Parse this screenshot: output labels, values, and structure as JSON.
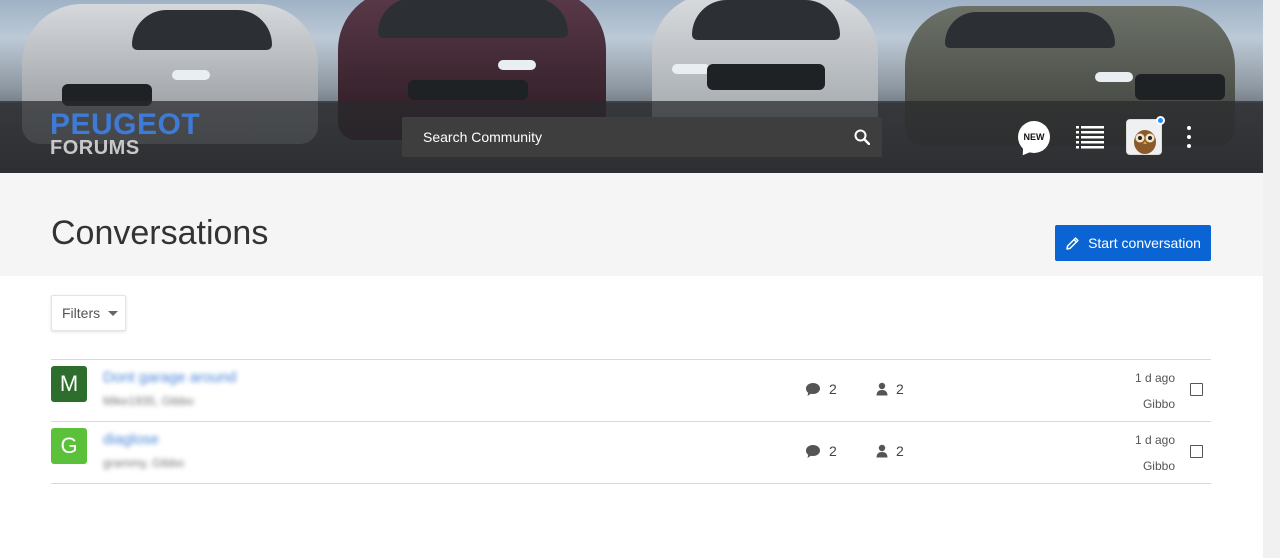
{
  "header": {
    "logo": {
      "top": "PEUGEOT",
      "bottom": "FORUMS"
    },
    "search": {
      "placeholder": "Search Community",
      "icon": "search-icon"
    },
    "new_badge": "NEW",
    "icons": [
      "new-posts-icon",
      "list-icon",
      "avatar",
      "kebab-menu-icon"
    ],
    "notification_color": "#1e8fff"
  },
  "page": {
    "title": "Conversations",
    "start_button": {
      "label": "Start conversation",
      "icon": "pencil-icon",
      "color": "#0b64d4"
    }
  },
  "filters": {
    "label": "Filters"
  },
  "conversations": [
    {
      "initial": "M",
      "avatar_color": "#2e6e2c",
      "title": "Dont garage around",
      "participants_text": "Mike1935, Gibbo",
      "replies": "2",
      "participants": "2",
      "time": "1 d ago",
      "last_by": "Gibbo"
    },
    {
      "initial": "G",
      "avatar_color": "#5cc13a",
      "title": "diaglose",
      "participants_text": "grammy, Gibbo",
      "replies": "2",
      "participants": "2",
      "time": "1 d ago",
      "last_by": "Gibbo"
    }
  ]
}
